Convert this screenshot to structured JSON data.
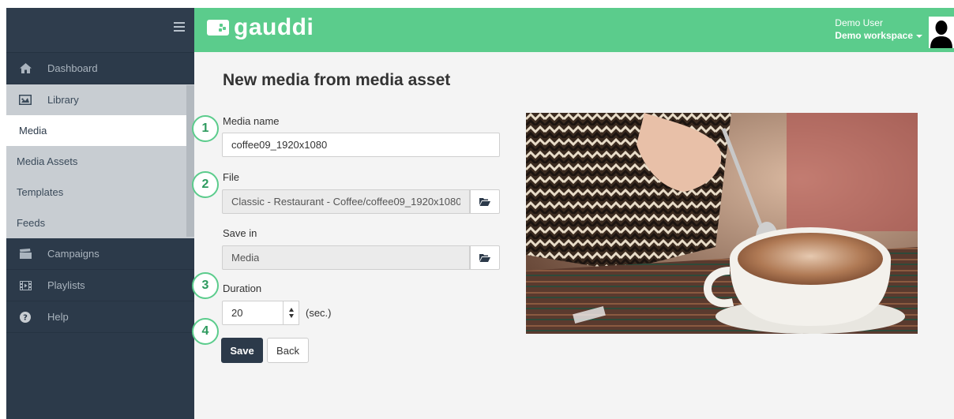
{
  "brand": {
    "name": "gauddi",
    "accent": "#5bcc8c",
    "sidebar_bg": "#2c3a4a"
  },
  "header": {
    "user_name": "Demo User",
    "workspace": "Demo workspace"
  },
  "sidebar": {
    "items": [
      {
        "label": "Dashboard",
        "icon": "home-icon"
      },
      {
        "label": "Library",
        "icon": "image-icon"
      },
      {
        "label": "Campaigns",
        "icon": "clapperboard-icon"
      },
      {
        "label": "Playlists",
        "icon": "film-icon"
      },
      {
        "label": "Help",
        "icon": "question-circle-icon"
      }
    ],
    "library_sub": [
      {
        "label": "Media",
        "active": true
      },
      {
        "label": "Media Assets"
      },
      {
        "label": "Templates"
      },
      {
        "label": "Feeds"
      }
    ]
  },
  "page": {
    "title": "New media from media asset"
  },
  "form": {
    "media_name_label": "Media name",
    "media_name_value": "coffee09_1920x1080",
    "file_label": "File",
    "file_value": "Classic - Restaurant - Coffee/coffee09_1920x1080",
    "save_in_label": "Save in",
    "save_in_value": "Media",
    "duration_label": "Duration",
    "duration_value": "20",
    "duration_unit": "(sec.)",
    "save_button": "Save",
    "back_button": "Back"
  },
  "badges": [
    "1",
    "2",
    "3",
    "4"
  ]
}
